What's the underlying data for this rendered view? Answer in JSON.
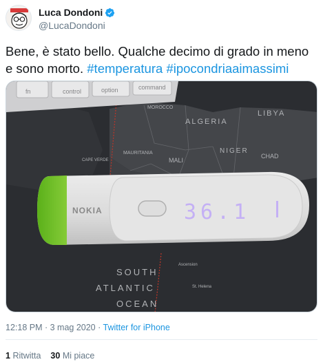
{
  "author": {
    "display_name": "Luca Dondoni",
    "handle": "@LucaDondoni",
    "verified": true
  },
  "tweet": {
    "text_prefix": "Bene, è stato bello. Qualche decimo di grado in meno e sono morto. ",
    "hashtags": [
      "#temperatura",
      "#ipocondriaaimassimi"
    ]
  },
  "media": {
    "device_brand": "NOKIA",
    "display_reading": "36.1",
    "map_labels": [
      "MOROCCO",
      "ALGERIA",
      "LIBYA",
      "MAURITANIA",
      "MALI",
      "NIGER",
      "CHAD",
      "CAPE VERDE",
      "SOUTH",
      "ATLANTIC",
      "OCEAN",
      "St. Helena",
      "Ascension"
    ],
    "keyboard_keys": [
      "control",
      "option",
      "command"
    ]
  },
  "meta": {
    "time": "12:18 PM · 3 mag 2020 · ",
    "source": "Twitter for iPhone"
  },
  "stats": {
    "retweets_count": "1",
    "retweets_label": "Ritwitta",
    "likes_count": "30",
    "likes_label": "Mi piace"
  },
  "colors": {
    "link": "#1b95e0",
    "text": "#14171a",
    "secondary": "#657786",
    "verified": "#1da1f2",
    "device_accent": "#74c42a"
  }
}
